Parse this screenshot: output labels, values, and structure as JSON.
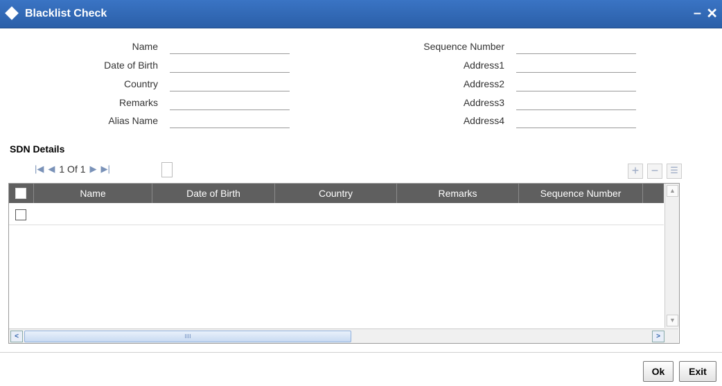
{
  "window": {
    "title": "Blacklist Check"
  },
  "form": {
    "left": [
      {
        "label": "Name",
        "value": ""
      },
      {
        "label": "Date of Birth",
        "value": ""
      },
      {
        "label": "Country",
        "value": ""
      },
      {
        "label": "Remarks",
        "value": ""
      },
      {
        "label": "Alias Name",
        "value": ""
      }
    ],
    "right": [
      {
        "label": "Sequence Number",
        "value": ""
      },
      {
        "label": "Address1",
        "value": ""
      },
      {
        "label": "Address2",
        "value": ""
      },
      {
        "label": "Address3",
        "value": ""
      },
      {
        "label": "Address4",
        "value": ""
      }
    ]
  },
  "sdn": {
    "section_title": "SDN Details",
    "pager": {
      "text": "1 Of 1",
      "current": 1,
      "total": 1
    },
    "columns": [
      "Name",
      "Date of Birth",
      "Country",
      "Remarks",
      "Sequence Number"
    ],
    "rows": [
      {
        "checked": false
      }
    ],
    "scroll_thumb_label": "IIII"
  },
  "buttons": {
    "ok": "Ok",
    "exit": "Exit"
  },
  "icons": {
    "first": "first-page-icon",
    "prev": "prev-page-icon",
    "next": "next-page-icon",
    "last": "last-page-icon",
    "add": "add-row-icon",
    "delete": "delete-row-icon",
    "view": "single-view-icon"
  },
  "colors": {
    "titlebar": "#2b5fa8",
    "grid_header": "#5f5f5f"
  }
}
